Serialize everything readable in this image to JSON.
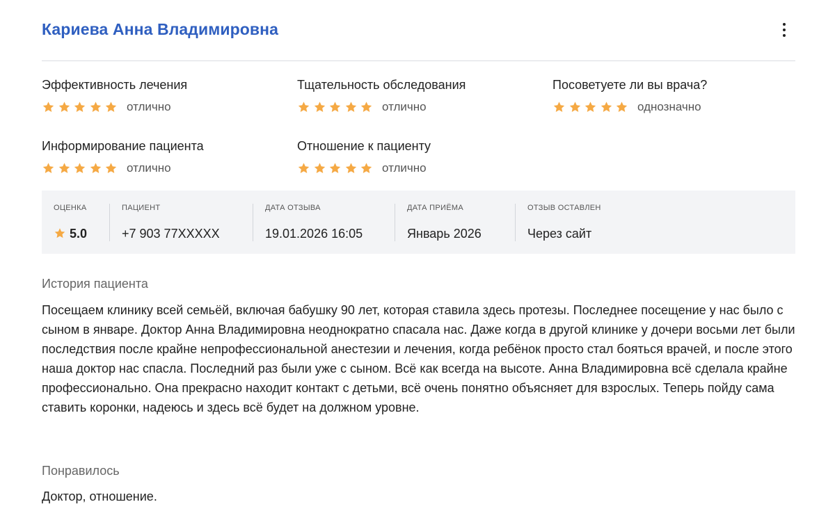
{
  "review": {
    "doctor_name": "Кариева Анна Владимировна",
    "menu_icon": "more-vertical-icon",
    "star_color": "#f5a944",
    "ratings": [
      {
        "label": "Эффективность лечения",
        "stars": 5,
        "text": "отлично"
      },
      {
        "label": "Тщательность обследования",
        "stars": 5,
        "text": "отлично"
      },
      {
        "label": "Посоветуете ли вы врача?",
        "stars": 5,
        "text": "однозначно"
      },
      {
        "label": "Информирование пациента",
        "stars": 5,
        "text": "отлично"
      },
      {
        "label": "Отношение к пациенту",
        "stars": 5,
        "text": "отлично"
      }
    ],
    "info": {
      "score_label": "Оценка",
      "score_value": "5.0",
      "patient_label": "Пациент",
      "patient_value": "+7 903 77XXXXX",
      "review_date_label": "Дата отзыва",
      "review_date_value": "19.01.2026 16:05",
      "visit_date_label": "Дата приёма",
      "visit_date_value": "Январь 2026",
      "source_label": "Отзыв оставлен",
      "source_value": "Через сайт"
    },
    "story": {
      "title": "История пациента",
      "text": "Посещаем клинику всей семьёй, включая бабушку 90 лет, которая ставила здесь протезы. Последнее посещение у нас было с сыном в январе. Доктор Анна Владимировна неоднократно спасала нас. Даже когда в другой клинике у дочери восьми лет были последствия после крайне непрофессиональной анестезии и лечения, когда ребёнок просто стал бояться врачей, и после этого наша доктор нас спасла. Последний раз были уже с сыном. Всё как всегда на высоте. Анна Владимировна всё сделала крайне профессионально. Она прекрасно находит контакт с детьми, всё очень понятно объясняет для взрослых. Теперь пойду сама ставить коронки, надеюсь и здесь всё будет на должном уровне."
    },
    "liked": {
      "title": "Понравилось",
      "text": "Доктор, отношение."
    }
  }
}
